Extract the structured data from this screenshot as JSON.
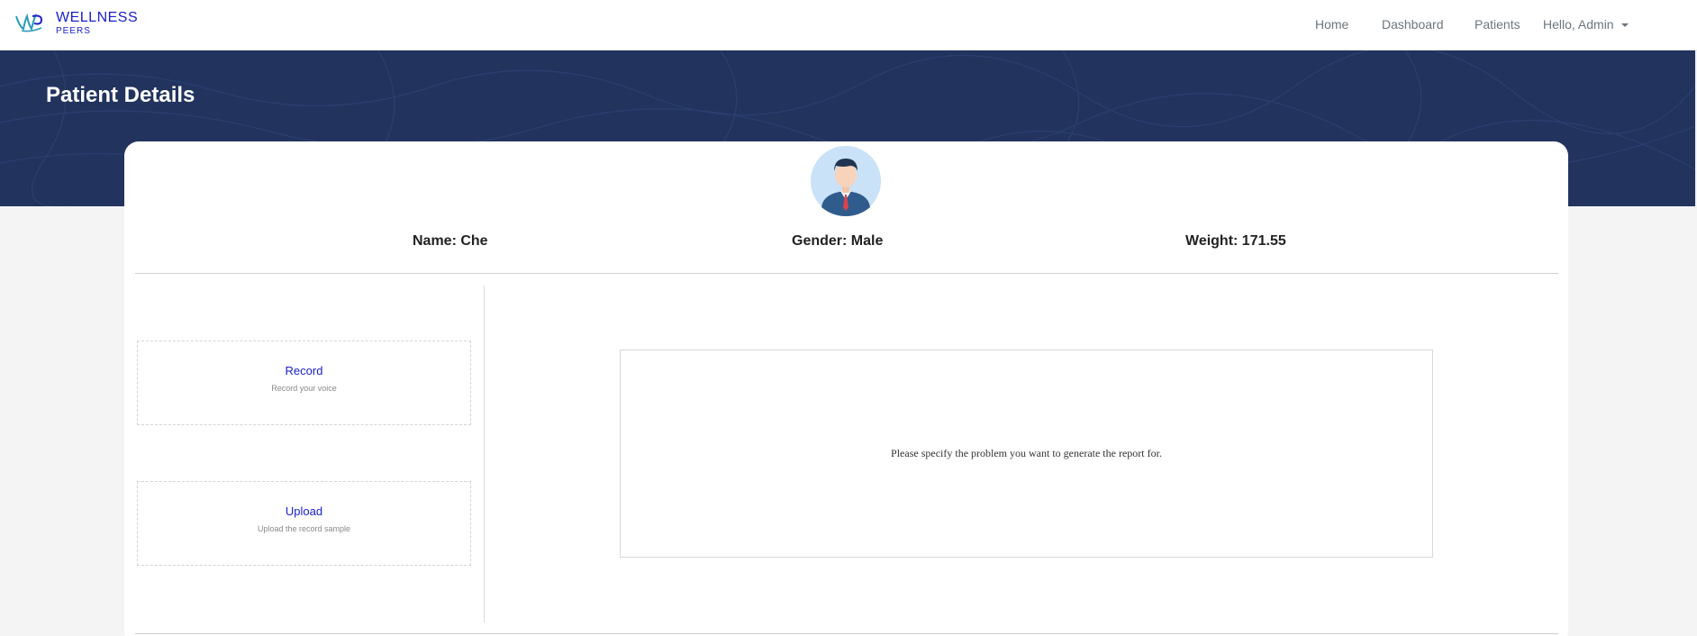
{
  "brand": {
    "title": "WELLNESS",
    "subtitle": "PEERS",
    "color": "#1a20c8"
  },
  "nav": {
    "home": "Home",
    "dashboard": "Dashboard",
    "patients": "Patients",
    "user_menu": "Hello, Admin"
  },
  "header": {
    "title": "Patient Details",
    "banner_color": "#22335e"
  },
  "patient": {
    "name": "Name: Che",
    "gender": "Gender: Male",
    "weight": "Weight: 171.55"
  },
  "actions": {
    "record": {
      "title": "Record",
      "subtitle": "Record your voice"
    },
    "upload": {
      "title": "Upload",
      "subtitle": "Upload the record sample"
    }
  },
  "report": {
    "message": "Please specify the problem you want to generate the report for."
  },
  "icons": {
    "logo": "wellness-peers-logo",
    "avatar": "businessman-avatar",
    "dropdown": "caret-down-icon"
  }
}
